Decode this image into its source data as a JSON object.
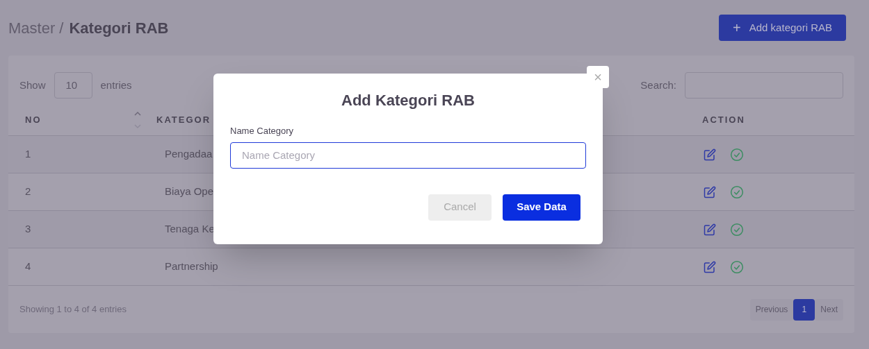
{
  "breadcrumb": {
    "parent": "Master /",
    "current": "Kategori RAB"
  },
  "add_button": {
    "icon": "+",
    "label": "Add kategori RAB"
  },
  "table_controls": {
    "show_label": "Show",
    "page_size": "10",
    "entries_label": "entries",
    "search_label": "Search:"
  },
  "table": {
    "columns": [
      "NO",
      "KATEGOR",
      "ACTION"
    ],
    "rows": [
      {
        "no": "1",
        "category": "Pengadaa"
      },
      {
        "no": "2",
        "category": "Biaya Ope"
      },
      {
        "no": "3",
        "category": "Tenaga Ke"
      },
      {
        "no": "4",
        "category": "Partnership"
      }
    ]
  },
  "footer": {
    "info": "Showing 1 to 4 of 4 entries",
    "previous": "Previous",
    "pages": [
      {
        "label": "1",
        "selected": true
      }
    ],
    "next": "Next"
  },
  "modal": {
    "title": "Add Kategori RAB",
    "field_label": "Name Category",
    "placeholder": "Name Category",
    "cancel": "Cancel",
    "save": "Save Data",
    "close": "×"
  }
}
